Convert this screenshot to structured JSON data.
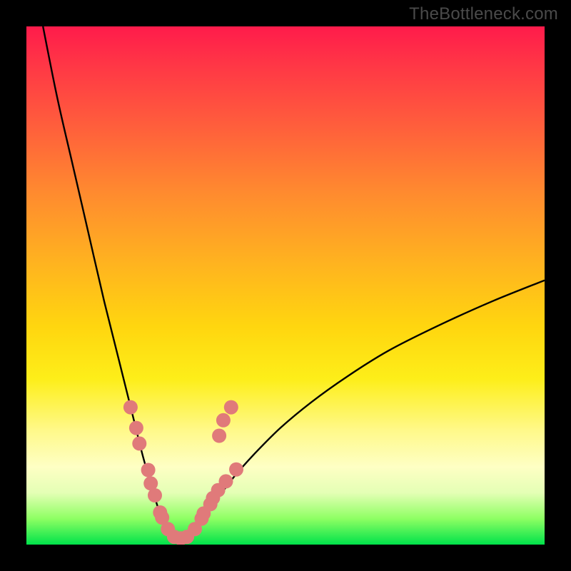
{
  "watermark": "TheBottleneck.com",
  "chart_data": {
    "type": "line",
    "title": "",
    "xlabel": "",
    "ylabel": "",
    "xlim": [
      0,
      1
    ],
    "ylim": [
      0,
      1
    ],
    "gradient_stops": [
      {
        "pos": 0.0,
        "color": "#ff1b4b"
      },
      {
        "pos": 0.07,
        "color": "#ff3546"
      },
      {
        "pos": 0.18,
        "color": "#ff5a3d"
      },
      {
        "pos": 0.32,
        "color": "#ff8a2f"
      },
      {
        "pos": 0.46,
        "color": "#ffb41f"
      },
      {
        "pos": 0.58,
        "color": "#ffd60f"
      },
      {
        "pos": 0.68,
        "color": "#fdee19"
      },
      {
        "pos": 0.78,
        "color": "#fff98a"
      },
      {
        "pos": 0.85,
        "color": "#feffc4"
      },
      {
        "pos": 0.9,
        "color": "#e4ffb5"
      },
      {
        "pos": 0.95,
        "color": "#8eff63"
      },
      {
        "pos": 1.0,
        "color": "#00e24a"
      }
    ],
    "series": [
      {
        "name": "bottleneck-curve",
        "x": [
          0.032,
          0.06,
          0.09,
          0.12,
          0.15,
          0.18,
          0.205,
          0.225,
          0.245,
          0.26,
          0.275,
          0.29,
          0.305,
          0.325,
          0.345,
          0.37,
          0.4,
          0.44,
          0.49,
          0.55,
          0.62,
          0.7,
          0.8,
          0.9,
          1.0
        ],
        "y": [
          0.0,
          0.14,
          0.27,
          0.4,
          0.53,
          0.65,
          0.75,
          0.83,
          0.9,
          0.945,
          0.97,
          0.985,
          0.985,
          0.97,
          0.945,
          0.91,
          0.87,
          0.825,
          0.775,
          0.725,
          0.675,
          0.625,
          0.575,
          0.53,
          0.49
        ]
      }
    ],
    "scatter_points": {
      "name": "markers",
      "color": "#e07a7a",
      "radius_px": 10,
      "points": [
        {
          "x": 0.201,
          "y": 0.735
        },
        {
          "x": 0.212,
          "y": 0.775
        },
        {
          "x": 0.218,
          "y": 0.805
        },
        {
          "x": 0.235,
          "y": 0.856
        },
        {
          "x": 0.24,
          "y": 0.882
        },
        {
          "x": 0.248,
          "y": 0.905
        },
        {
          "x": 0.258,
          "y": 0.938
        },
        {
          "x": 0.262,
          "y": 0.948
        },
        {
          "x": 0.273,
          "y": 0.97
        },
        {
          "x": 0.285,
          "y": 0.985
        },
        {
          "x": 0.298,
          "y": 0.988
        },
        {
          "x": 0.31,
          "y": 0.985
        },
        {
          "x": 0.325,
          "y": 0.97
        },
        {
          "x": 0.338,
          "y": 0.95
        },
        {
          "x": 0.342,
          "y": 0.94
        },
        {
          "x": 0.355,
          "y": 0.922
        },
        {
          "x": 0.36,
          "y": 0.91
        },
        {
          "x": 0.37,
          "y": 0.895
        },
        {
          "x": 0.385,
          "y": 0.878
        },
        {
          "x": 0.405,
          "y": 0.855
        },
        {
          "x": 0.395,
          "y": 0.735
        },
        {
          "x": 0.38,
          "y": 0.76
        },
        {
          "x": 0.372,
          "y": 0.79
        }
      ]
    }
  }
}
